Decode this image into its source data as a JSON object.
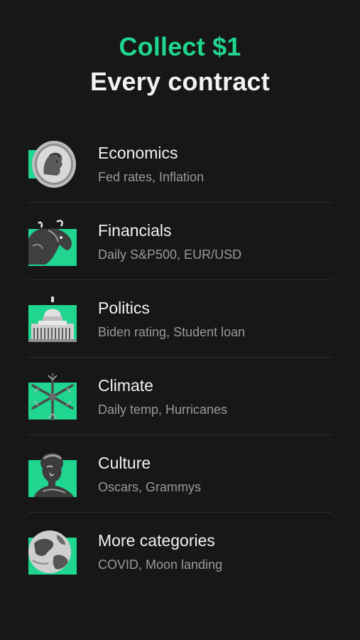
{
  "hero": {
    "line1": "Collect $1",
    "line2": "Every contract"
  },
  "colors": {
    "accent": "#1fd58f",
    "background": "#171717",
    "divider": "#2e2e2e",
    "subtitle": "#9a9a9a"
  },
  "categories": [
    {
      "title": "Economics",
      "subtitle": "Fed rates, Inflation",
      "icon": "coin-icon"
    },
    {
      "title": "Financials",
      "subtitle": "Daily S&P500, EUR/USD",
      "icon": "bull-icon"
    },
    {
      "title": "Politics",
      "subtitle": "Biden rating, Student loan",
      "icon": "capitol-icon"
    },
    {
      "title": "Climate",
      "subtitle": "Daily temp, Hurricanes",
      "icon": "snowflake-icon"
    },
    {
      "title": "Culture",
      "subtitle": "Oscars, Grammys",
      "icon": "statue-bust-icon"
    },
    {
      "title": "More categories",
      "subtitle": "COVID, Moon landing",
      "icon": "earth-icon"
    }
  ]
}
